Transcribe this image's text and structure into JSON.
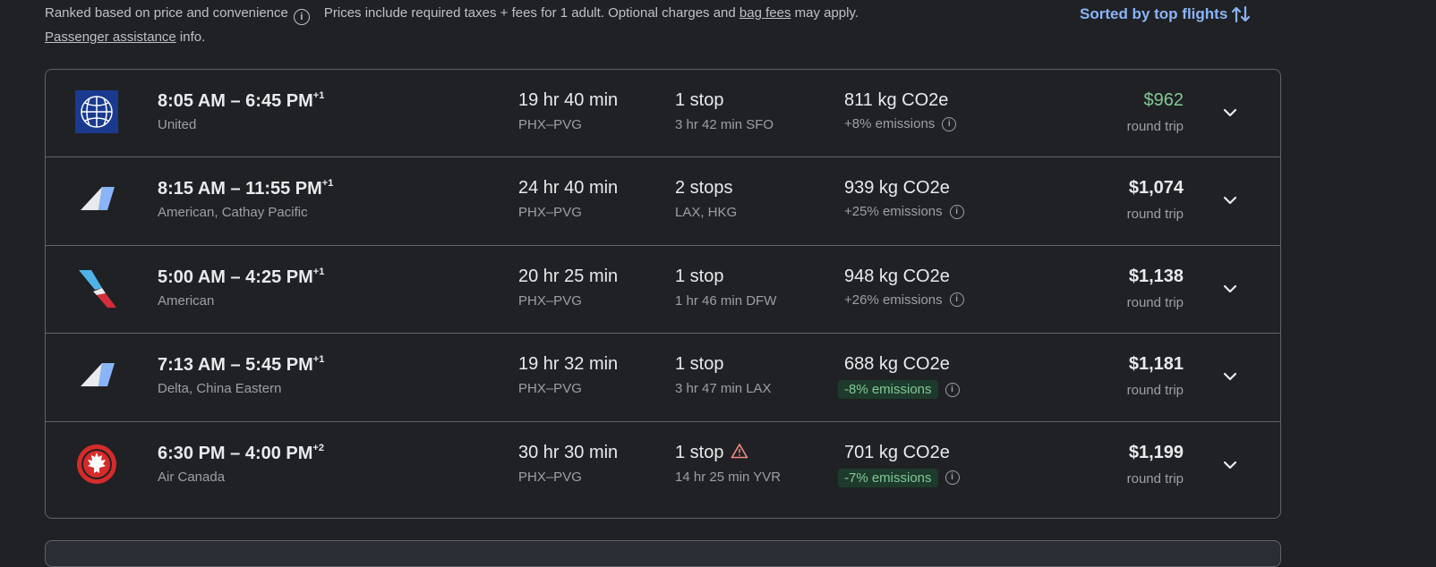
{
  "header": {
    "ranked_text": "Ranked based on price and convenience",
    "prices_text_a": "Prices include required taxes + fees for 1 adult. Optional charges and ",
    "bag_fees_link": "bag fees",
    "prices_text_b": " may apply.",
    "passenger_link": "Passenger assistance",
    "passenger_suffix": " info.",
    "sorted_label": "Sorted by top flights",
    "info_glyph": "i"
  },
  "flights": [
    {
      "logo": "united-globe-icon",
      "times": "8:05 AM – 6:45 PM",
      "day_offset": "+1",
      "airline": "United",
      "duration": "19 hr 40 min",
      "route": "PHX–PVG",
      "stops": "1 stop",
      "stop_detail": "3 hr 42 min SFO",
      "co2": "811 kg CO2e",
      "emissions": "+8% emissions",
      "price": "$962",
      "price_type": "round trip"
    },
    {
      "logo": "multi-airline-icon",
      "times": "8:15 AM – 11:55 PM",
      "day_offset": "+1",
      "airline": "American, Cathay Pacific",
      "duration": "24 hr 40 min",
      "route": "PHX–PVG",
      "stops": "2 stops",
      "stop_detail": "LAX, HKG",
      "co2": "939 kg CO2e",
      "emissions": "+25% emissions",
      "price": "$1,074",
      "price_type": "round trip"
    },
    {
      "logo": "american-airlines-icon",
      "times": "5:00 AM – 4:25 PM",
      "day_offset": "+1",
      "airline": "American",
      "duration": "20 hr 25 min",
      "route": "PHX–PVG",
      "stops": "1 stop",
      "stop_detail": "1 hr 46 min DFW",
      "co2": "948 kg CO2e",
      "emissions": "+26% emissions",
      "price": "$1,138",
      "price_type": "round trip"
    },
    {
      "logo": "multi-airline-icon",
      "times": "7:13 AM – 5:45 PM",
      "day_offset": "+1",
      "airline": "Delta, China Eastern",
      "duration": "19 hr 32 min",
      "route": "PHX–PVG",
      "stops": "1 stop",
      "stop_detail": "3 hr 47 min LAX",
      "co2": "688 kg CO2e",
      "emissions": "-8% emissions",
      "price": "$1,181",
      "price_type": "round trip"
    },
    {
      "logo": "air-canada-icon",
      "times": "6:30 PM – 4:00 PM",
      "day_offset": "+2",
      "airline": "Air Canada",
      "duration": "30 hr 30 min",
      "route": "PHX–PVG",
      "stops": "1 stop",
      "stop_detail": "14 hr 25 min YVR",
      "co2": "701 kg CO2e",
      "emissions": "-7% emissions",
      "price": "$1,199",
      "price_type": "round trip"
    }
  ],
  "colors": {
    "background": "#202124",
    "accent_link": "#8ab4f8",
    "low_price_green": "#81c995",
    "low_emissions_badge": "#1e3a2c",
    "warning_red": "#f28b82"
  }
}
